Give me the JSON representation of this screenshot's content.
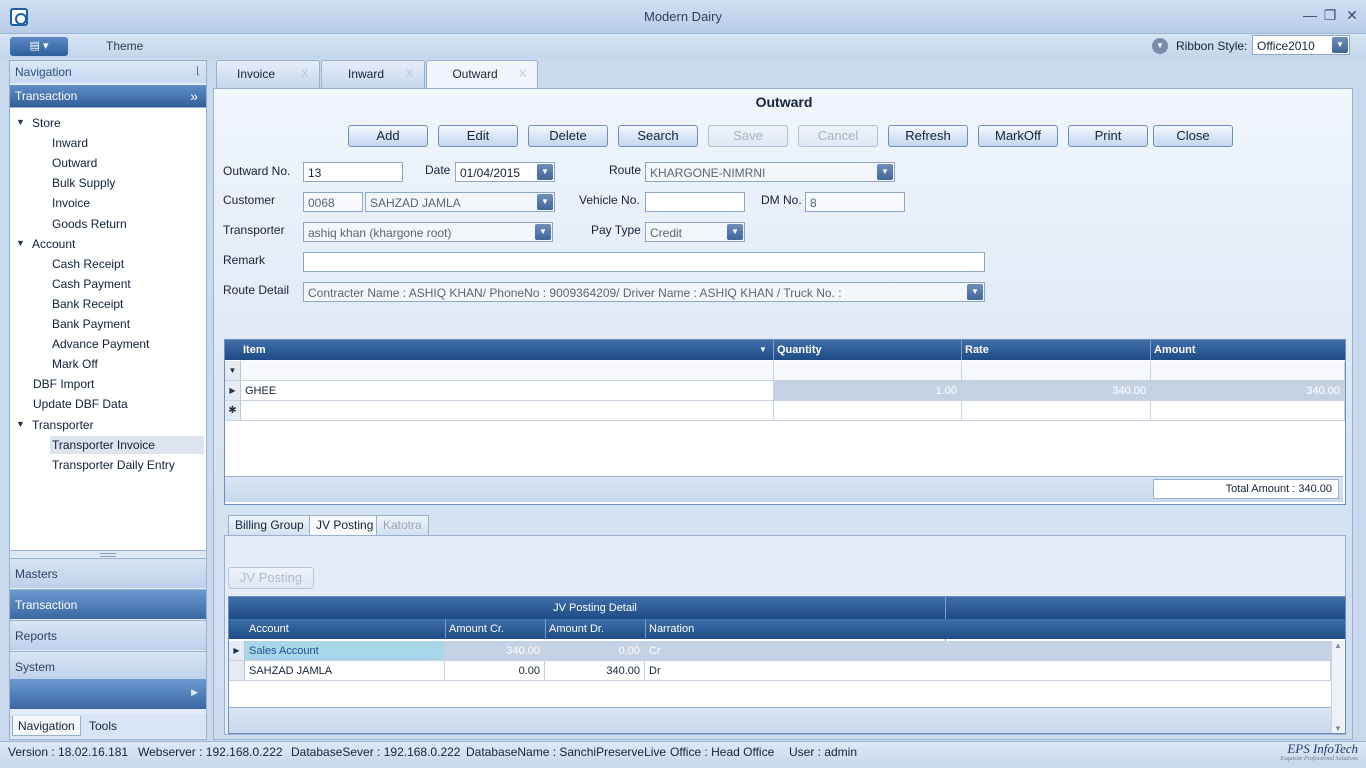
{
  "window": {
    "title": "Modern Dairy",
    "minimize_icon": "minimize-icon",
    "restore_icon": "restore-icon",
    "close_icon": "close-icon"
  },
  "ribbon": {
    "theme_label": "Theme",
    "ribbon_style_label": "Ribbon Style:",
    "ribbon_style_value": "Office2010"
  },
  "nav": {
    "header": "Navigation",
    "group": "Transaction",
    "tree": [
      {
        "label": "Store",
        "level": 0,
        "expanded": true
      },
      {
        "label": "Inward",
        "level": 1
      },
      {
        "label": "Outward",
        "level": 1
      },
      {
        "label": "Bulk Supply",
        "level": 1
      },
      {
        "label": "Invoice",
        "level": 1
      },
      {
        "label": "Goods Return",
        "level": 1
      },
      {
        "label": "Account",
        "level": 0,
        "expanded": true
      },
      {
        "label": "Cash Receipt",
        "level": 1
      },
      {
        "label": "Cash Payment",
        "level": 1
      },
      {
        "label": "Bank Receipt",
        "level": 1
      },
      {
        "label": "Bank Payment",
        "level": 1
      },
      {
        "label": "Advance Payment",
        "level": 1
      },
      {
        "label": "Mark Off",
        "level": 1
      },
      {
        "label": "DBF Import",
        "level": 0
      },
      {
        "label": "Update DBF Data",
        "level": 0
      },
      {
        "label": "Transporter",
        "level": 0,
        "expanded": true
      },
      {
        "label": "Transporter Invoice",
        "level": 1,
        "selected": true
      },
      {
        "label": "Transporter Daily Entry",
        "level": 1
      }
    ],
    "groups": [
      "Masters",
      "Transaction",
      "Reports",
      "System"
    ],
    "active_group": "Transaction",
    "bottom_tabs": [
      "Navigation",
      "Tools"
    ]
  },
  "tabs": [
    "Invoice",
    "Inward",
    "Outward"
  ],
  "active_tab": "Outward",
  "tab_close": "X",
  "form": {
    "title": "Outward",
    "buttons": [
      {
        "label": "Add",
        "enabled": true
      },
      {
        "label": "Edit",
        "enabled": true
      },
      {
        "label": "Delete",
        "enabled": true
      },
      {
        "label": "Search",
        "enabled": true
      },
      {
        "label": "Save",
        "enabled": false
      },
      {
        "label": "Cancel",
        "enabled": false
      },
      {
        "label": "Refresh",
        "enabled": true
      },
      {
        "label": "MarkOff",
        "enabled": true
      },
      {
        "label": "Print",
        "enabled": true
      },
      {
        "label": "Close",
        "enabled": true
      }
    ],
    "outward_no_label": "Outward No.",
    "outward_no": "13",
    "date_label": "Date",
    "date": "01/04/2015",
    "route_label": "Route",
    "route": "KHARGONE-NIMRNI",
    "customer_label": "Customer",
    "customer_code": "0068",
    "customer_name": "SAHZAD JAMLA",
    "vehicle_label": "Vehicle No.",
    "vehicle_no": "",
    "dm_label": "DM No.",
    "dm_no": "8",
    "transporter_label": "Transporter",
    "transporter": "ashiq khan (khargone root)",
    "paytype_label": "Pay Type",
    "paytype": "Credit",
    "remark_label": "Remark",
    "remark": "",
    "route_detail_label": "Route Detail",
    "route_detail": "Contracter Name : ASHIQ KHAN/ PhoneNo : 9009364209/ Driver Name : ASHIQ KHAN / Truck No. :"
  },
  "items_grid": {
    "columns": [
      "Item",
      "Quantity",
      "Rate",
      "Amount"
    ],
    "rows": [
      {
        "item": "GHEE",
        "quantity": "1.00",
        "rate": "340.00",
        "amount": "340.00"
      }
    ],
    "total": "Total Amount : 340.00"
  },
  "lower_tabs": [
    "Billing Group",
    "JV Posting",
    "Katotra"
  ],
  "lower_active": "JV Posting",
  "jv_button": "JV Posting",
  "jv_grid": {
    "band": "JV Posting Detail",
    "columns": [
      "Account",
      "Amount Cr.",
      "Amount Dr.",
      "Narration"
    ],
    "rows": [
      {
        "account": "Sales Account",
        "cr": "340.00",
        "dr": "0.00",
        "narration": "Cr"
      },
      {
        "account": "SAHZAD JAMLA",
        "cr": "0.00",
        "dr": "340.00",
        "narration": "Dr"
      }
    ]
  },
  "status": {
    "version": "Version : 18.02.16.181",
    "webserver": "Webserver : 192.168.0.222",
    "dbserver": "DatabaseSever : 192.168.0.222",
    "dbname": "DatabaseName : SanchiPreserveLive",
    "office": "Office : Head Office",
    "user": "User : admin",
    "brand": "EPS InfoTech",
    "brand_sub": "Exquisite Professional Solutions"
  }
}
